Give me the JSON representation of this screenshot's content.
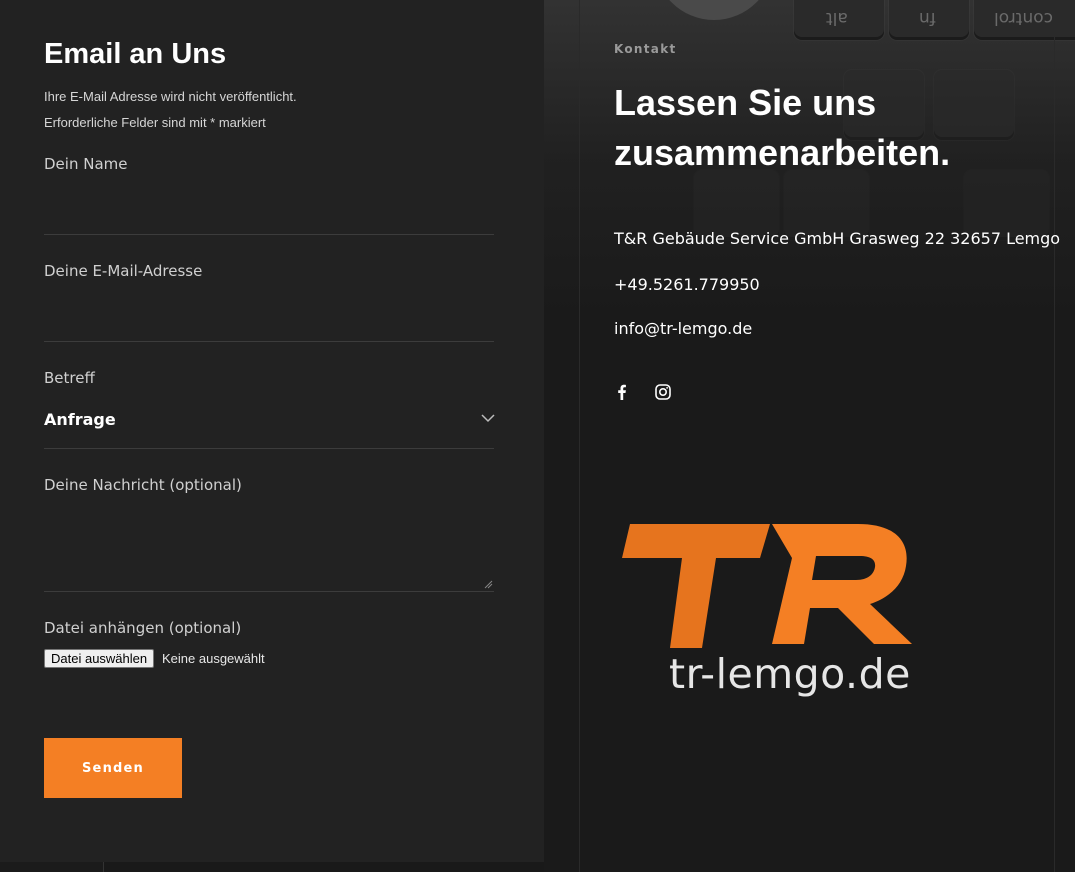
{
  "form": {
    "title": "Email an Uns",
    "note_line1": "Ihre E-Mail Adresse wird nicht veröffentlicht.",
    "note_line2": "Erforderliche Felder sind mit * markiert",
    "name_label": "Dein Name",
    "name_value": "",
    "email_label": "Deine E-Mail-Adresse",
    "email_value": "",
    "subject_label": "Betreff",
    "subject_selected": "Anfrage",
    "message_label": "Deine Nachricht (optional)",
    "message_value": "",
    "attachment_label": "Datei anhängen (optional)",
    "file_button_label": "Datei auswählen",
    "file_status": "Keine ausgewählt",
    "submit_label": "Senden"
  },
  "contact": {
    "kicker": "Kontakt",
    "heading": "Lassen Sie uns zusammenarbeiten.",
    "address": "T&R Gebäude Service GmbH Grasweg 22 32657 Lemgo",
    "phone": "+49.5261.779950",
    "email": "info@tr-lemgo.de",
    "social": [
      "facebook-icon",
      "instagram-icon"
    ]
  },
  "background_keys": [
    "alt",
    "fn",
    "control"
  ],
  "logo": {
    "letters": "TR",
    "domain": "tr-lemgo.de",
    "color": "#f47f24"
  },
  "colors": {
    "accent": "#f47f24",
    "panel": "#222222",
    "background": "#1a1a1a",
    "text": "#ffffff"
  }
}
